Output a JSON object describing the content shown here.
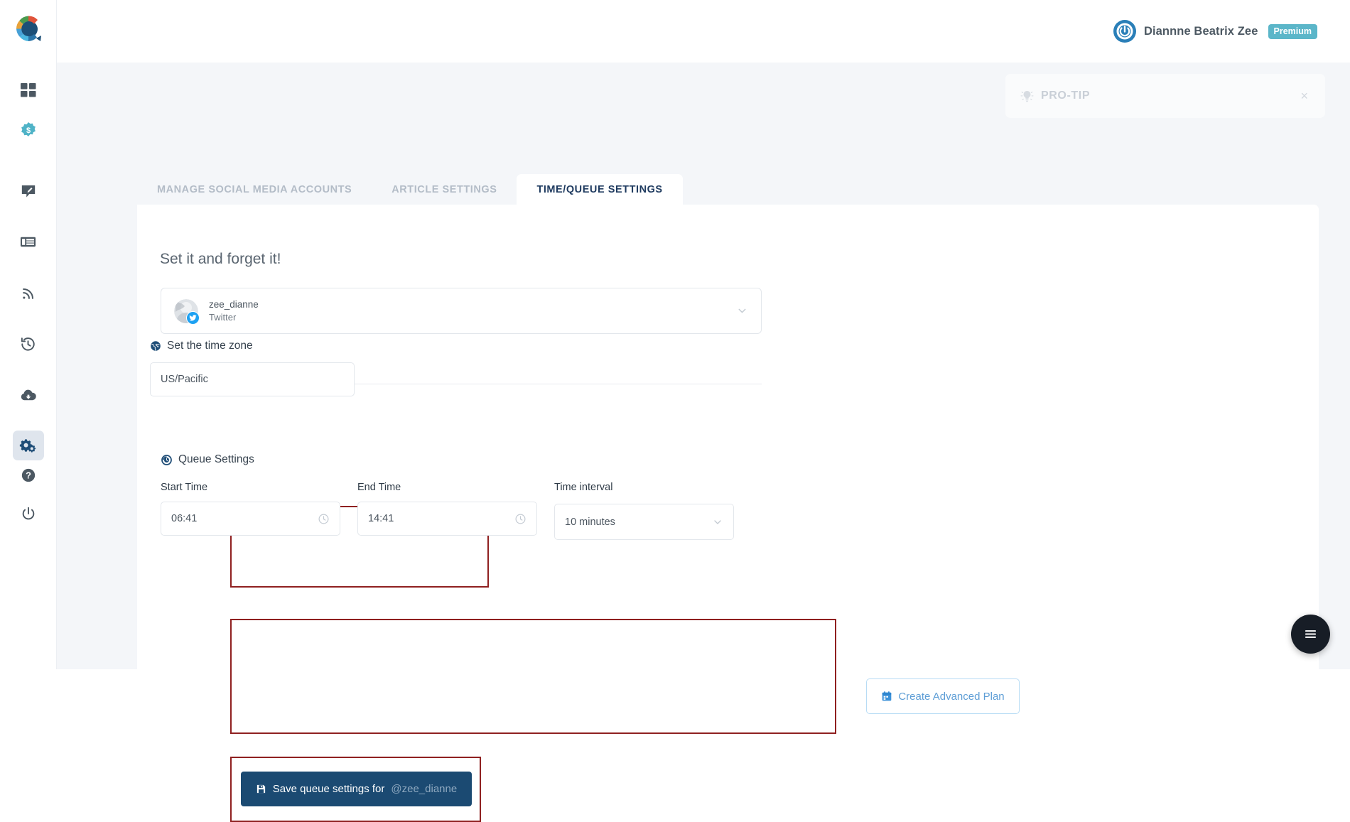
{
  "brand": {
    "logo_icon": "app-logo-circular"
  },
  "sidebar": {
    "items": [
      {
        "icon": "grid-dashboard-icon",
        "name": "dashboard",
        "active": false
      },
      {
        "icon": "money-badge-icon",
        "name": "earnings",
        "active": false
      },
      {
        "icon": "compose-pencil-icon",
        "name": "compose",
        "active": false
      },
      {
        "icon": "list-table-icon",
        "name": "content-list",
        "active": false
      },
      {
        "icon": "rss-feed-icon",
        "name": "rss-feeds",
        "active": false
      },
      {
        "icon": "history-clock-icon",
        "name": "history",
        "active": false
      },
      {
        "icon": "cloud-download-icon",
        "name": "downloads",
        "active": false
      },
      {
        "icon": "gears-settings-icon",
        "name": "settings",
        "active": true
      },
      {
        "icon": "help-question-icon",
        "name": "help",
        "active": false
      },
      {
        "icon": "power-logout-icon",
        "name": "logout",
        "active": false
      }
    ]
  },
  "header": {
    "user_name": "Diannne Beatrix Zee",
    "plan_badge": "Premium",
    "avatar_icon": "user-power-avatar"
  },
  "protip": {
    "label": "PRO-TIP",
    "icon": "lightbulb-icon",
    "close_icon": "close-icon",
    "close_label": "×"
  },
  "tabs": [
    {
      "label": "MANAGE SOCIAL MEDIA ACCOUNTS",
      "active": false
    },
    {
      "label": "ARTICLE SETTINGS",
      "active": false
    },
    {
      "label": "TIME/QUEUE SETTINGS",
      "active": true
    }
  ],
  "main": {
    "section_title": "Set it and forget it!",
    "account_selector": {
      "handle": "zee_dianne",
      "network": "Twitter",
      "network_icon": "twitter-bird-icon",
      "chevron_icon": "chevron-down-icon"
    },
    "timezone": {
      "heading": "Set the time zone",
      "icon": "globe-icon",
      "value": "US/Pacific",
      "placeholder": "US/Pacific"
    },
    "queue": {
      "heading": "Queue Settings",
      "icon": "queue-refresh-clock-icon",
      "fields": [
        {
          "label": "Start Time",
          "value": "06:41",
          "trail_icon": "clock-icon",
          "type": "time"
        },
        {
          "label": "End Time",
          "value": "14:41",
          "trail_icon": "clock-icon",
          "type": "time"
        },
        {
          "label": "Time interval",
          "value": "10 minutes",
          "trail_icon": "chevron-down-icon",
          "type": "select"
        }
      ]
    },
    "advanced_plan": {
      "label": "Create Advanced Plan",
      "icon": "calendar-icon"
    },
    "save": {
      "label": "Save queue settings for",
      "handle": "@zee_dianne",
      "icon": "floppy-save-icon"
    }
  },
  "fab": {
    "icon": "hamburger-menu-icon"
  },
  "colors": {
    "accent_dark": "#1b4a72",
    "accent_light": "#3d92d9",
    "premium_badge": "#5bb6c9",
    "highlight_border": "#8f2020",
    "page_bg": "#f4f6f9",
    "active_nav_bg": "#dfe5ed"
  }
}
